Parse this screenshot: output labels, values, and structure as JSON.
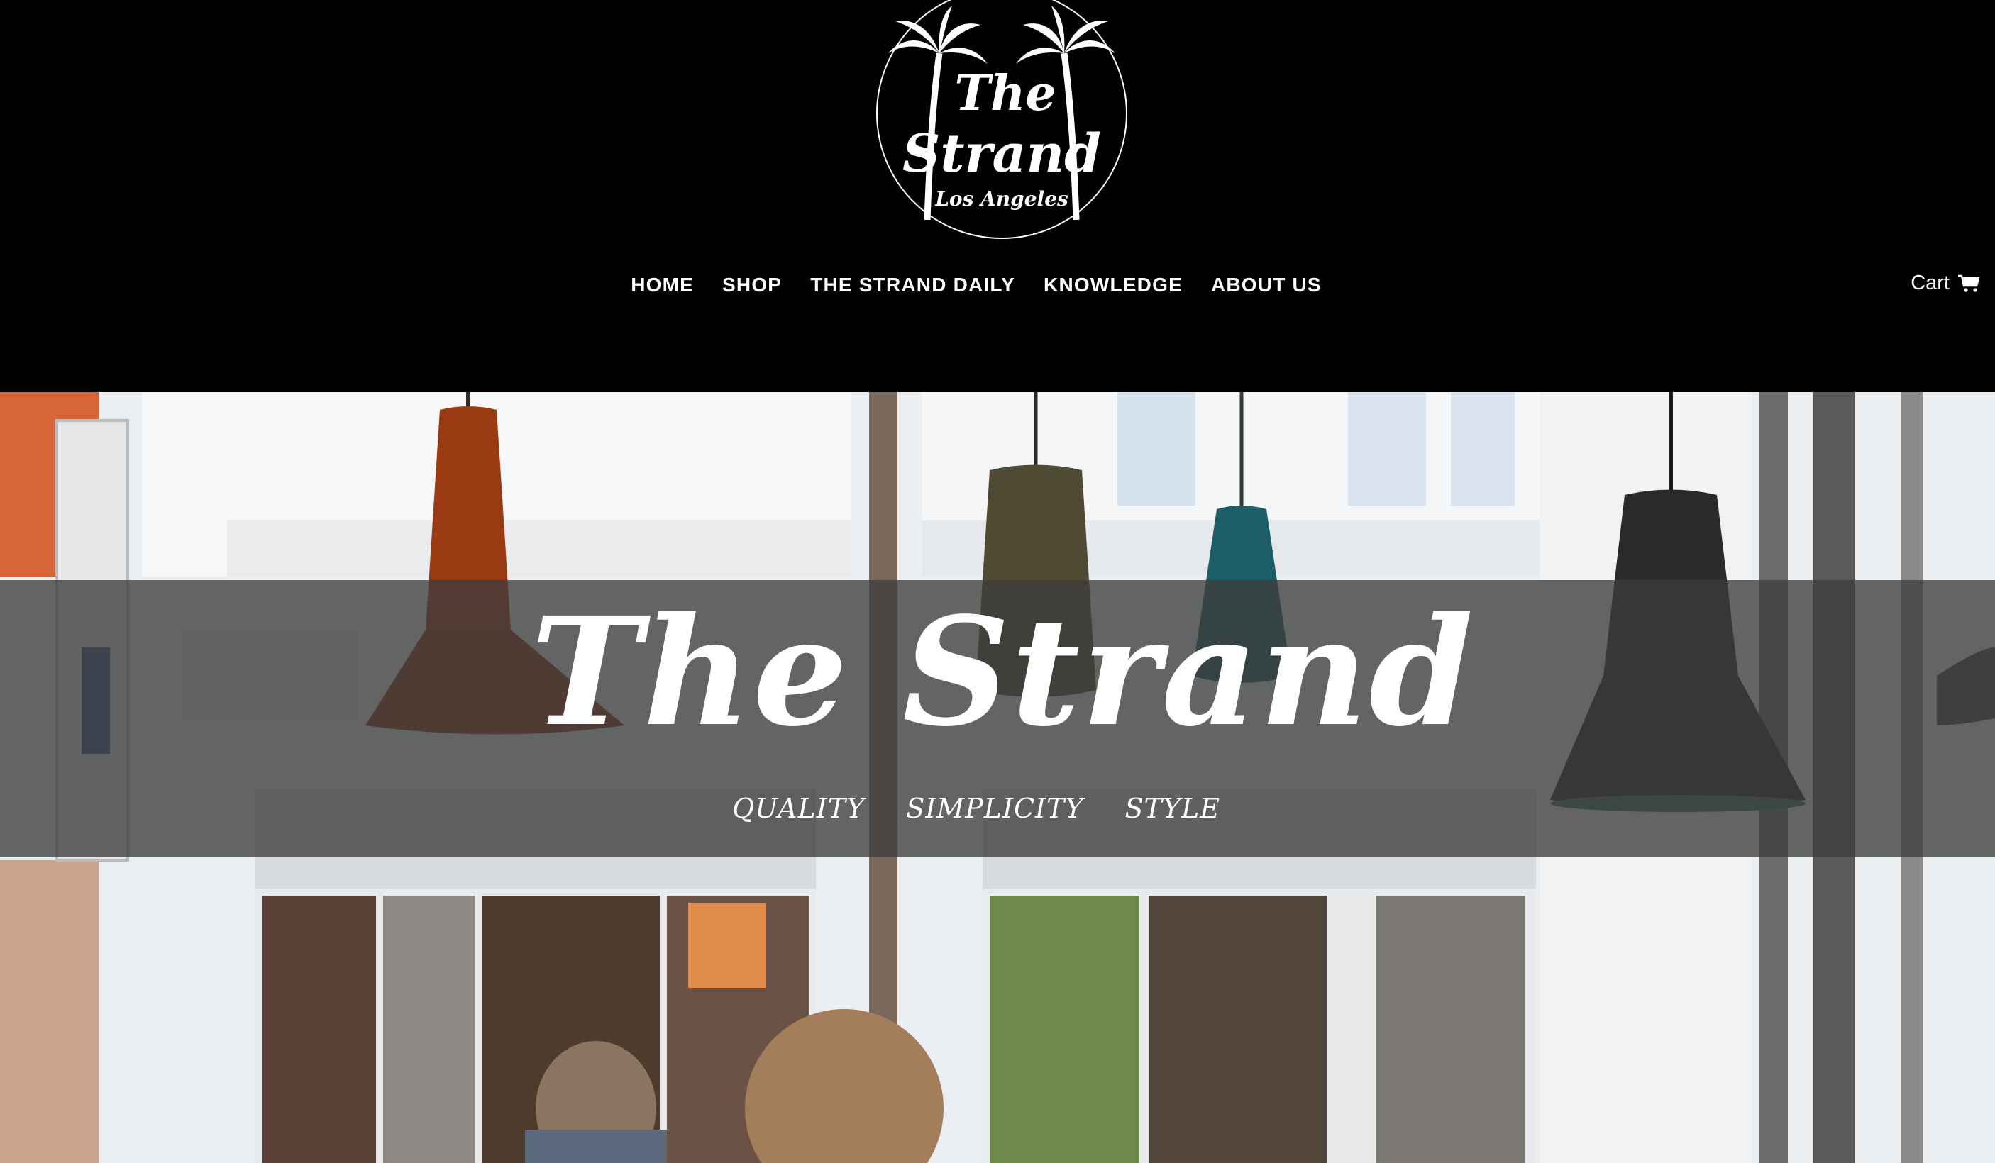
{
  "logo": {
    "line1": "The",
    "line2": "Strand",
    "line3": "Los Angeles"
  },
  "nav": {
    "items": [
      {
        "label": "HOME"
      },
      {
        "label": "SHOP"
      },
      {
        "label": "THE STRAND DAILY"
      },
      {
        "label": "KNOWLEDGE"
      },
      {
        "label": "ABOUT US"
      }
    ]
  },
  "cart": {
    "label": "Cart",
    "icon": "shopping-cart-icon"
  },
  "hero": {
    "title": "The Strand",
    "tagline": [
      "QUALITY",
      "SIMPLICITY",
      "STYLE"
    ]
  },
  "colors": {
    "header_bg": "#000000",
    "nav_text": "#ffffff",
    "hero_band": "rgba(60,60,60,0.78)"
  }
}
